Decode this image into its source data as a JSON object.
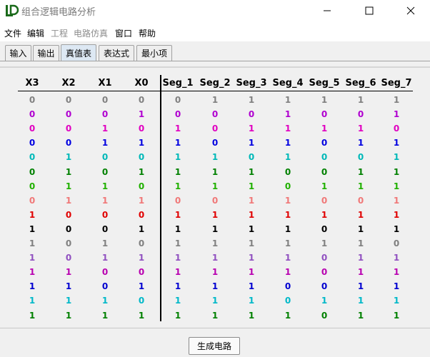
{
  "window": {
    "title": "组合逻辑电路分析"
  },
  "menu": [
    {
      "label": "文件",
      "enabled": true
    },
    {
      "label": "编辑",
      "enabled": true
    },
    {
      "label": "工程",
      "enabled": false
    },
    {
      "label": "电路仿真",
      "enabled": false
    },
    {
      "label": "窗口",
      "enabled": true
    },
    {
      "label": "帮助",
      "enabled": true
    }
  ],
  "tabs": [
    {
      "label": "输入",
      "active": false
    },
    {
      "label": "输出",
      "active": false
    },
    {
      "label": "真值表",
      "active": true
    },
    {
      "label": "表达式",
      "active": false
    },
    {
      "label": "最小项",
      "active": false
    }
  ],
  "table": {
    "headers": [
      "X3",
      "X2",
      "X1",
      "X0",
      "Seg_1",
      "Seg_2",
      "Seg_3",
      "Seg_4",
      "Seg_5",
      "Seg_6",
      "Seg_7"
    ],
    "row_colors": [
      "#808080",
      "#b000d0",
      "#e000c0",
      "#0000e0",
      "#00b8b8",
      "#008000",
      "#20b000",
      "#f07878",
      "#e00000",
      "#000000",
      "#808080",
      "#9050c0",
      "#b800b0",
      "#0000d0",
      "#00b8c8",
      "#008000"
    ],
    "rows": [
      [
        "0",
        "0",
        "0",
        "0",
        "0",
        "1",
        "1",
        "1",
        "1",
        "1",
        "1"
      ],
      [
        "0",
        "0",
        "0",
        "1",
        "0",
        "0",
        "0",
        "1",
        "0",
        "0",
        "1"
      ],
      [
        "0",
        "0",
        "1",
        "0",
        "1",
        "0",
        "1",
        "1",
        "1",
        "1",
        "0"
      ],
      [
        "0",
        "0",
        "1",
        "1",
        "1",
        "0",
        "1",
        "1",
        "0",
        "1",
        "1"
      ],
      [
        "0",
        "1",
        "0",
        "0",
        "1",
        "1",
        "0",
        "1",
        "0",
        "0",
        "1"
      ],
      [
        "0",
        "1",
        "0",
        "1",
        "1",
        "1",
        "1",
        "0",
        "0",
        "1",
        "1"
      ],
      [
        "0",
        "1",
        "1",
        "0",
        "1",
        "1",
        "1",
        "0",
        "1",
        "1",
        "1"
      ],
      [
        "0",
        "1",
        "1",
        "1",
        "0",
        "0",
        "1",
        "1",
        "0",
        "0",
        "1"
      ],
      [
        "1",
        "0",
        "0",
        "0",
        "1",
        "1",
        "1",
        "1",
        "1",
        "1",
        "1"
      ],
      [
        "1",
        "0",
        "0",
        "1",
        "1",
        "1",
        "1",
        "1",
        "0",
        "1",
        "1"
      ],
      [
        "1",
        "0",
        "1",
        "0",
        "1",
        "1",
        "1",
        "1",
        "1",
        "1",
        "0"
      ],
      [
        "1",
        "0",
        "1",
        "1",
        "1",
        "1",
        "1",
        "1",
        "0",
        "1",
        "1"
      ],
      [
        "1",
        "1",
        "0",
        "0",
        "1",
        "1",
        "1",
        "1",
        "0",
        "1",
        "1"
      ],
      [
        "1",
        "1",
        "0",
        "1",
        "1",
        "1",
        "1",
        "0",
        "0",
        "1",
        "1"
      ],
      [
        "1",
        "1",
        "1",
        "0",
        "1",
        "1",
        "1",
        "0",
        "1",
        "1",
        "1"
      ],
      [
        "1",
        "1",
        "1",
        "1",
        "1",
        "1",
        "1",
        "1",
        "0",
        "1",
        "1"
      ]
    ]
  },
  "footer": {
    "generate_button": "生成电路"
  }
}
